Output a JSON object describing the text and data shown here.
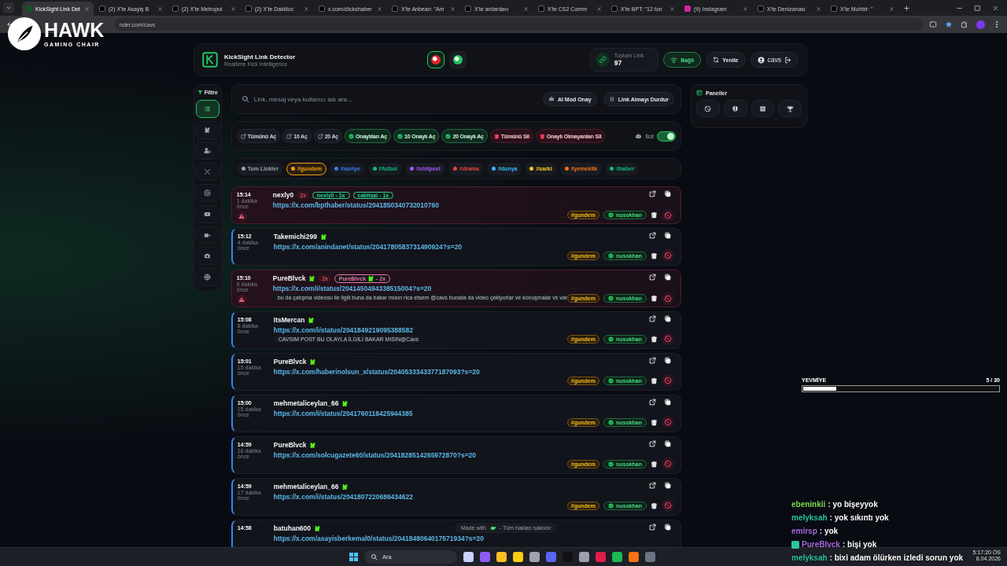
{
  "browser": {
    "tabs": [
      {
        "title": "KickSight Link Det",
        "selected": true
      },
      {
        "title": "(2) X'te Asayiş B",
        "selected": false
      },
      {
        "title": "(2) X'te Metropol",
        "selected": false
      },
      {
        "title": "(2) X'te Daktiloc",
        "selected": false
      },
      {
        "title": "x.com/clickshaber",
        "selected": false
      },
      {
        "title": "X'te Anbean: \"Am",
        "selected": false
      },
      {
        "title": "X'te ardardavı",
        "selected": false
      },
      {
        "title": "X'te CS2 Comm",
        "selected": false
      },
      {
        "title": "X'te BPT: \"12 ton",
        "selected": false
      },
      {
        "title": "(9) Instagram",
        "selected": false
      },
      {
        "title": "X'te Denizanası",
        "selected": false
      },
      {
        "title": "X'te Muhbir: \"",
        "selected": false
      }
    ],
    "url": "nder.com/cavs"
  },
  "logo_overlay": {
    "title": "HAWK",
    "subtitle": "GAMING CHAIR"
  },
  "app": {
    "title": "KickSight Link Detector",
    "subtitle": "Realtime Kick Intelligence",
    "mode_buttons": [
      {
        "selected": true
      },
      {
        "selected": false
      }
    ],
    "stat_label": "Toplam Link",
    "stat_value": "97",
    "status": "Bağlı",
    "refresh": "Yenile",
    "user": "cavs"
  },
  "filter": {
    "label": "Filtre",
    "items": [
      {
        "selected": true
      },
      {
        "selected": false
      },
      {
        "selected": false
      },
      {
        "selected": false
      },
      {
        "selected": false
      },
      {
        "selected": false
      },
      {
        "selected": false
      },
      {
        "selected": false
      },
      {
        "selected": false
      }
    ]
  },
  "search": {
    "placeholder": "Link, mesaj veya kullanıcı adı ara...",
    "buttons": [
      "AI Mod Onay",
      "Link Almayı Durdur"
    ]
  },
  "actions": [
    {
      "kind": "open",
      "label": "Tümünü Aç"
    },
    {
      "kind": "open",
      "label": "10 Aç"
    },
    {
      "kind": "open",
      "label": "20 Aç"
    },
    {
      "kind": "approved",
      "label": "Onaylıları Aç"
    },
    {
      "kind": "approved",
      "label": "10 Onaylı Aç"
    },
    {
      "kind": "approved",
      "label": "20 Onaylı Aç"
    },
    {
      "kind": "delete",
      "label": "Tümünü Sil"
    },
    {
      "kind": "delete",
      "label": "Onaylı Olmayanları Sil"
    }
  ],
  "bot": {
    "label": "Bot",
    "on": true
  },
  "tags": [
    {
      "label": "Tum Linkler",
      "color": "#9ca3af",
      "selected": false
    },
    {
      "label": "#gundem",
      "color": "#f59e0b",
      "selected": true
    },
    {
      "label": "#suriye",
      "color": "#3b82f6",
      "selected": false
    },
    {
      "label": "#futbol",
      "color": "#10b981",
      "selected": false
    },
    {
      "label": "#shitpost",
      "color": "#a855f7",
      "selected": false
    },
    {
      "label": "#drama",
      "color": "#ef4444",
      "selected": false
    },
    {
      "label": "#dunya",
      "color": "#38bdf8",
      "selected": false
    },
    {
      "label": "#sarki",
      "color": "#facc15",
      "selected": false
    },
    {
      "label": "#yemeklik",
      "color": "#f97316",
      "selected": false
    },
    {
      "label": "#haber",
      "color": "#10b981",
      "selected": false
    }
  ],
  "panels": {
    "title": "Paneller"
  },
  "links": [
    {
      "time": "15:14",
      "ago": "1 dakika önce",
      "user": "nexly0",
      "verified": false,
      "count": "2x",
      "mentions": [
        {
          "name": "nexly0",
          "verified": false,
          "suffix": "- 1x",
          "color": "#34d399"
        },
        {
          "name": "cabilsai",
          "verified": false,
          "suffix": "- 1x",
          "color": "#34d399"
        }
      ],
      "url": "https://x.com/bpthaber/status/2041850340732010760",
      "flagged": true,
      "tag": "#gundem",
      "approver": "nusokhan"
    },
    {
      "time": "15:12",
      "ago": "4 dakika önce",
      "user": "Takemichi299",
      "verified": true,
      "url": "https://x.com/anindanet/status/2041780583731490924?s=20",
      "flagged": false,
      "tag": "#gundem",
      "approver": "nusokhan"
    },
    {
      "time": "15:10",
      "ago": "6 dakika önce",
      "user": "PureBlvck",
      "verified": true,
      "count": "2x",
      "mentions": [
        {
          "name": "PureBlvck",
          "verified": true,
          "suffix": "- 2x",
          "color": "#f472b6"
        }
      ],
      "url": "https://x.com/i/status/2041450494338515004?s=20",
      "note": "bu da çatışma videosu ile ilgili buna da bakar mısın rica etsem @cavs burada da video çekiyorlar ve konuşmalar vs var",
      "flagged": true,
      "tag": "#gundem",
      "approver": "nusokhan"
    },
    {
      "time": "15:08",
      "ago": "8 dakika önce",
      "user": "ItsMercan",
      "verified": true,
      "url": "https://x.com/i/status/2041849219095388582",
      "note": "CAVSIM POST BU OLAYLA İLGİLİ BAKAR MISIN@Cavs",
      "flagged": false,
      "tag": "#gundem",
      "approver": "nusokhan"
    },
    {
      "time": "15:01",
      "ago": "15 dakika önce",
      "user": "PureBlvck",
      "verified": true,
      "url": "https://x.com/haberinolsun_x/status/2040533343377187093?s=20",
      "flagged": false,
      "tag": "#gundem",
      "approver": "nusokhan"
    },
    {
      "time": "15:00",
      "ago": "15 dakika önce",
      "user": "mehmetaliceylan_66",
      "verified": true,
      "url": "https://x.com/i/status/2041760118425944385",
      "flagged": false,
      "tag": "#gundem",
      "approver": "nusokhan"
    },
    {
      "time": "14:59",
      "ago": "16 dakika önce",
      "user": "PureBlvck",
      "verified": true,
      "url": "https://x.com/solcugazete60/status/2041828514265972870?s=20",
      "flagged": false,
      "tag": "#gundem",
      "approver": "nusokhan"
    },
    {
      "time": "14:59",
      "ago": "17 dakika önce",
      "user": "mehmetaliceylan_66",
      "verified": true,
      "url": "https://x.com/i/status/2041807220686434622",
      "flagged": false,
      "tag": "#gundem",
      "approver": "nusokhan"
    },
    {
      "time": "14:58",
      "user": "batuhan600",
      "verified": true,
      "url": "https://x.com/asayisberkemal0/status/2041848064017571934?s=20",
      "flagged": false
    }
  ],
  "footer": {
    "before": "Made with",
    "after": "- Tüm hakları saklıdır"
  },
  "yevmiye": {
    "label": "YEVMİYE",
    "count": "5 / 30",
    "level": 0.17
  },
  "chat": [
    {
      "user": "ebeninkii",
      "color": "#7ed957",
      "text": ": yo bişeyyok",
      "badge": false
    },
    {
      "user": "melyksah",
      "color": "#2ec4a0",
      "text": ": yok sıkıntı yok",
      "badge": false
    },
    {
      "user": "emirsp",
      "color": "#a56bdf",
      "text": ": yok",
      "badge": false
    },
    {
      "user": "PureBlvck",
      "color": "#a56bdf",
      "text": ": bişi yok",
      "badge": true
    },
    {
      "user": "melyksah",
      "color": "#2ec4a0",
      "text": ": bixi adam ölürken izledi sorun yok",
      "badge": false
    }
  ],
  "taskbar": {
    "search": "Ara",
    "time": "5:17:20 ÖS",
    "date": "8.04.2026"
  }
}
